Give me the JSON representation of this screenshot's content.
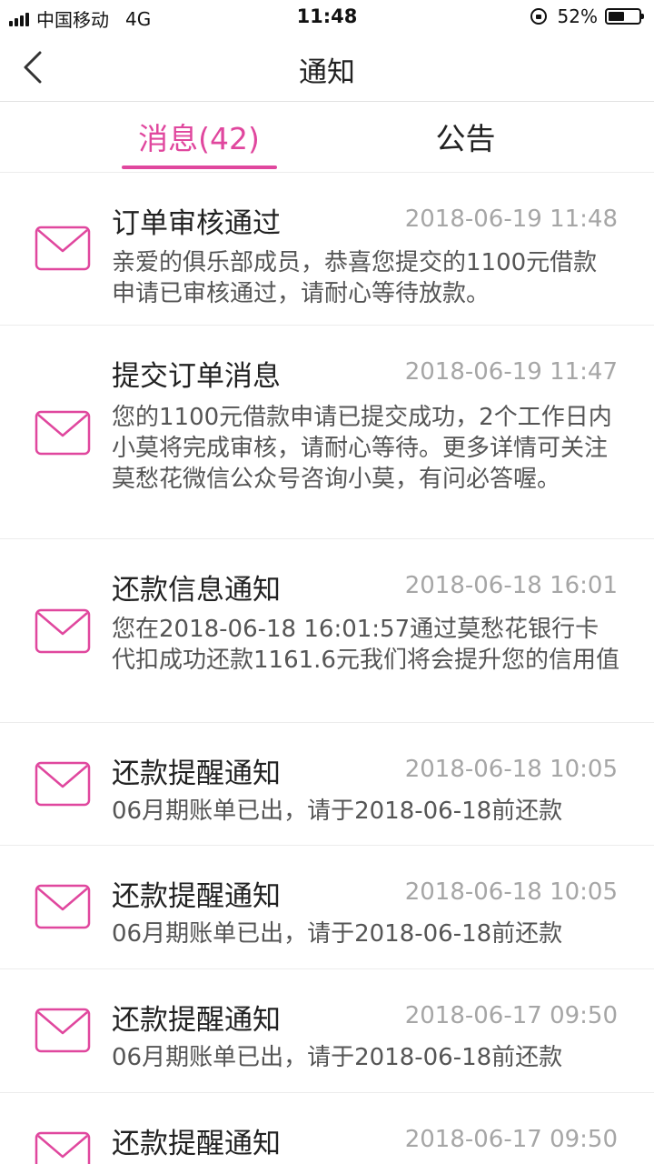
{
  "status_bar": {
    "carrier": "中国移动",
    "network": "4G",
    "time": "11:48",
    "battery": "52%",
    "battery_level": 0.52
  },
  "nav": {
    "title": "通知"
  },
  "tabs": {
    "messages": "消息(42)",
    "announcements": "公告"
  },
  "colors": {
    "accent": "#e0479e"
  },
  "icons": {
    "back": "chevron-left-icon",
    "mail": "mail-envelope-icon"
  },
  "notifications": [
    {
      "title": "订单审核通过",
      "time": "2018-06-19 11:48",
      "body": "亲爱的俱乐部成员，恭喜您提交的1100元借款申请已审核通过，请耐心等待放款。"
    },
    {
      "title": "提交订单消息",
      "time": "2018-06-19 11:47",
      "body": "您的1100元借款申请已提交成功，2个工作日内小莫将完成审核，请耐心等待。更多详情可关注莫愁花微信公众号咨询小莫，有问必答喔。"
    },
    {
      "title": "还款信息通知",
      "time": "2018-06-18 16:01",
      "body": "您在2018-06-18 16:01:57通过莫愁花银行卡代扣成功还款1161.6元我们将会提升您的信用值"
    },
    {
      "title": "还款提醒通知",
      "time": "2018-06-18 10:05",
      "body": "06月期账单已出，请于2018-06-18前还款"
    },
    {
      "title": "还款提醒通知",
      "time": "2018-06-18 10:05",
      "body": "06月期账单已出，请于2018-06-18前还款"
    },
    {
      "title": "还款提醒通知",
      "time": "2018-06-17 09:50",
      "body": "06月期账单已出，请于2018-06-18前还款"
    },
    {
      "title": "还款提醒通知",
      "time": "2018-06-17 09:50",
      "body": ""
    }
  ]
}
